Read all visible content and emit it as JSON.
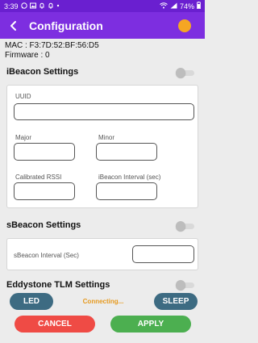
{
  "status_bar": {
    "time": "3:39",
    "battery": "74%",
    "icons": [
      "whatsapp-icon",
      "gallery-icon",
      "bell-icon",
      "bell-icon",
      "dot-icon",
      "wifi-icon",
      "signal-icon",
      "battery-icon"
    ]
  },
  "app_bar": {
    "title": "Configuration",
    "back_icon": "back-arrow-icon",
    "status_color": "#f5a623"
  },
  "device": {
    "mac": "MAC : F3:7D:52:BF:56:D5",
    "firmware": "Firmware : 0"
  },
  "ibeacon": {
    "title": "iBeacon Settings",
    "enabled": false,
    "uuid_label": "UUID",
    "uuid_value": "",
    "major_label": "Major",
    "major_value": "",
    "minor_label": "Minor",
    "minor_value": "",
    "rssi_label": "Calibrated RSSI",
    "rssi_value": "",
    "interval_label": "iBeacon Interval (sec)",
    "interval_value": ""
  },
  "sbeacon": {
    "title": "sBeacon Settings",
    "enabled": false,
    "interval_label": "sBeacon Interval (Sec)",
    "interval_value": ""
  },
  "eddystone": {
    "title": "Eddystone TLM Settings",
    "enabled": false
  },
  "actions": {
    "led_label": "LED",
    "connecting_text": "Connecting...",
    "sleep_label": "SLEEP",
    "cancel_label": "CANCEL",
    "apply_label": "APPLY"
  },
  "colors": {
    "primary": "#7d2ee0",
    "status_bar": "#6a1fd0",
    "led_sleep": "#3d6b82",
    "cancel": "#ef4b45",
    "apply": "#4caf50",
    "connecting": "#e69a1f"
  }
}
